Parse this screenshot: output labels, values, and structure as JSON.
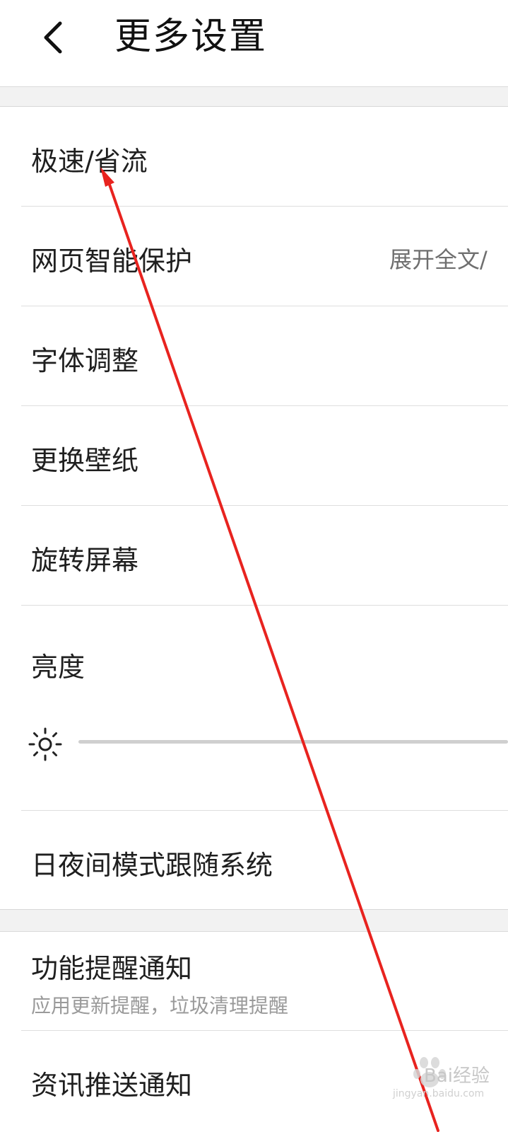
{
  "header": {
    "title": "更多设置",
    "back_icon": "chevron-left-icon"
  },
  "settings": {
    "speed": {
      "label": "极速/省流"
    },
    "web_protection": {
      "label": "网页智能保护",
      "value": "展开全文/"
    },
    "font": {
      "label": "字体调整"
    },
    "wallpaper": {
      "label": "更换壁纸"
    },
    "rotate": {
      "label": "旋转屏幕"
    },
    "brightness": {
      "label": "亮度",
      "icon": "sun-icon"
    },
    "day_night": {
      "label": "日夜间模式跟随系统"
    },
    "feature_notify": {
      "label": "功能提醒通知",
      "sub": "应用更新提醒，垃圾清理提醒"
    },
    "news_push": {
      "label": "资讯推送通知"
    }
  },
  "watermark": {
    "brand": "Bai",
    "brand_tail": "经验",
    "url": "jingyan.baidu.com"
  },
  "colors": {
    "arrow": "#e8231f",
    "divider": "#dedede",
    "section_gap": "#f2f2f2"
  }
}
